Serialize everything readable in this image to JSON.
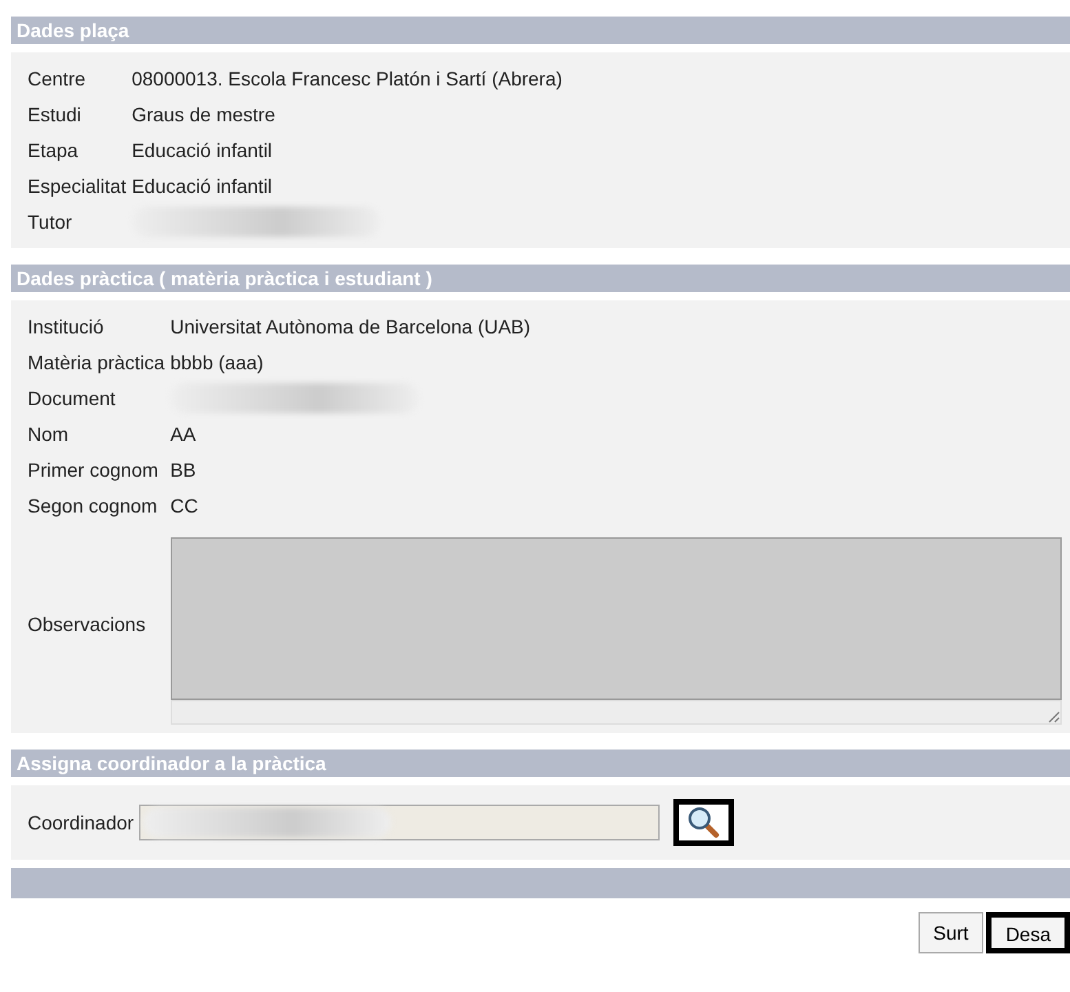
{
  "sections": [
    {
      "title": "Dades plaça",
      "rows": [
        {
          "kind": "text",
          "label": "Centre",
          "value": "08000013. Escola Francesc Platón i Sartí (Abrera)"
        },
        {
          "kind": "text",
          "label": "Estudi",
          "value": "Graus de mestre"
        },
        {
          "kind": "text",
          "label": "Etapa",
          "value": "Educació infantil"
        },
        {
          "kind": "text",
          "label": "Especialitat",
          "value": "Educació infantil"
        },
        {
          "kind": "blurred",
          "label": "Tutor"
        }
      ]
    },
    {
      "title": "Dades pràctica ( matèria pràctica i estudiant )",
      "rows": [
        {
          "kind": "text",
          "label": "Institució",
          "value": "Universitat Autònoma de Barcelona (UAB)"
        },
        {
          "kind": "text",
          "label": "Matèria pràctica",
          "value": "bbbb (aaa)"
        },
        {
          "kind": "blurred",
          "label": "Document"
        },
        {
          "kind": "text",
          "label": "Nom",
          "value": "AA"
        },
        {
          "kind": "text",
          "label": "Primer cognom",
          "value": "BB"
        },
        {
          "kind": "text",
          "label": "Segon cognom",
          "value": "CC"
        },
        {
          "kind": "textarea",
          "label": "Observacions"
        }
      ]
    },
    {
      "title": "Assigna coordinador a la pràctica",
      "rows": [
        {
          "kind": "lookup",
          "label": "Coordinador",
          "highlighted": true
        }
      ]
    }
  ],
  "buttons": [
    {
      "label": "Surt",
      "highlighted": false
    },
    {
      "label": "Desa",
      "highlighted": true
    }
  ]
}
